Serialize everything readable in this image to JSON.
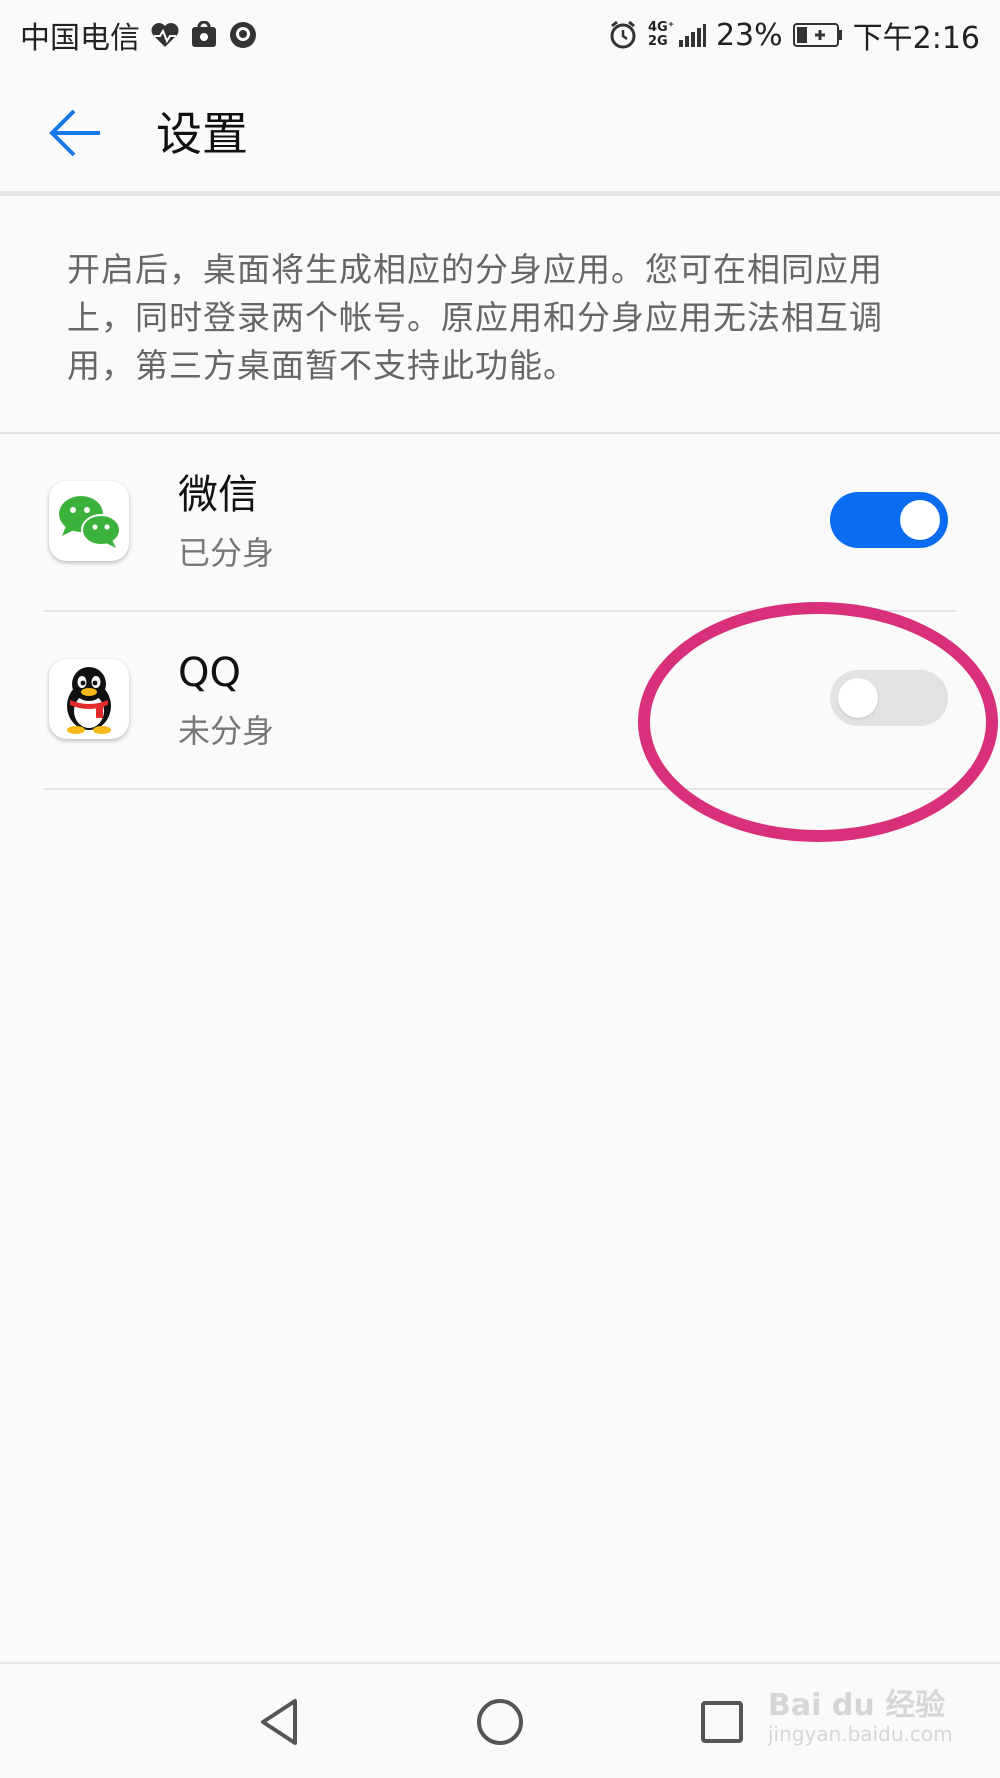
{
  "status_bar": {
    "carrier": "中国电信",
    "network": "4G⁺ 2G",
    "battery_percent": "23%",
    "time": "下午2:16"
  },
  "header": {
    "title": "设置"
  },
  "description": "开启后，桌面将生成相应的分身应用。您可在相同应用上，同时登录两个帐号。原应用和分身应用无法相互调用，第三方桌面暂不支持此功能。",
  "apps": [
    {
      "name": "微信",
      "status": "已分身",
      "enabled": true,
      "icon": "wechat-icon"
    },
    {
      "name": "QQ",
      "status": "未分身",
      "enabled": false,
      "icon": "qq-icon"
    }
  ],
  "colors": {
    "accent": "#0a6cf0",
    "highlight": "#d8307a",
    "toggle_off": "#e2e2e2"
  },
  "watermark": {
    "brand": "Bai du 经验",
    "url": "jingyan.baidu.com"
  }
}
